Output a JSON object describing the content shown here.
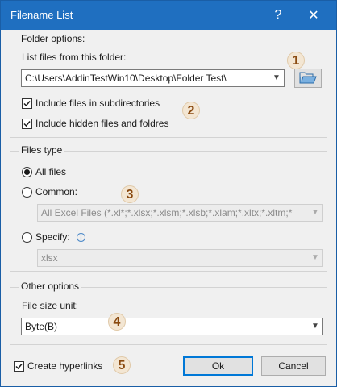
{
  "window": {
    "title": "Filename List",
    "help_glyph": "?",
    "close_glyph": "✕"
  },
  "folder_options": {
    "group_label": "Folder options:",
    "list_label": "List files from this folder:",
    "folder_path": "C:\\Users\\AddinTestWin10\\Desktop\\Folder Test\\",
    "include_subdirectories": {
      "label": "Include files in subdirectories",
      "checked": true
    },
    "include_hidden": {
      "label": "Include hidden files and foldres",
      "checked": true
    }
  },
  "files_type": {
    "group_label": "Files type",
    "all_files": {
      "label": "All files",
      "selected": true
    },
    "common": {
      "label": "Common:",
      "selected": false,
      "value": "All Excel Files (*.xl*;*.xlsx;*.xlsm;*.xlsb;*.xlam;*.xltx;*.xltm;*"
    },
    "specify": {
      "label": "Specify:",
      "selected": false,
      "value": "xlsx"
    }
  },
  "other_options": {
    "group_label": "Other options",
    "size_unit_label": "File size unit:",
    "size_unit_value": "Byte(B)"
  },
  "footer": {
    "create_hyperlinks": {
      "label": "Create hyperlinks",
      "checked": true
    },
    "ok_label": "Ok",
    "cancel_label": "Cancel"
  },
  "annotations": [
    "1",
    "2",
    "3",
    "4",
    "5"
  ],
  "colors": {
    "titlebar": "#1f6fc0",
    "badge_bg": "#f3e6d3",
    "badge_text": "#8a4a10",
    "default_button_border": "#0078d7"
  }
}
